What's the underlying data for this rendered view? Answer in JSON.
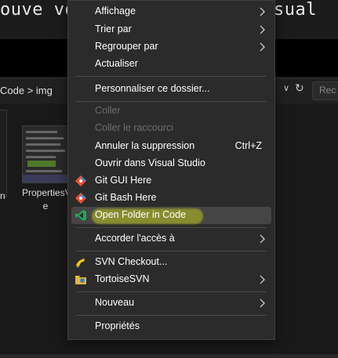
{
  "background": {
    "title_left": "ouve vo",
    "title_right": "sual",
    "address_path": "Code > img",
    "search_placeholder": "Rec",
    "left_tile_label": "n",
    "thumbnail_label": "PropertiesV e"
  },
  "context_menu": {
    "affichage": "Affichage",
    "trier_par": "Trier par",
    "regrouper_par": "Regrouper par",
    "actualiser": "Actualiser",
    "personnaliser": "Personnaliser ce dossier...",
    "coller": "Coller",
    "coller_raccourci": "Coller le raccourci",
    "annuler_suppression": "Annuler la suppression",
    "annuler_shortcut": "Ctrl+Z",
    "ouvrir_vs": "Ouvrir dans Visual Studio",
    "git_gui": "Git GUI Here",
    "git_bash": "Git Bash Here",
    "open_code": "Open Folder in Code",
    "accorder_acces": "Accorder l'accès à",
    "svn_checkout": "SVN Checkout...",
    "tortoise": "TortoiseSVN",
    "nouveau": "Nouveau",
    "proprietes": "Propriétés"
  },
  "icons": {
    "git_gui": "git-diamond-icon",
    "git_bash": "git-diamond-icon",
    "open_code": "vscode-icon",
    "svn_checkout": "svn-checkout-icon",
    "tortoise": "tortoise-svn-icon"
  },
  "colors": {
    "menu_bg": "#2b2b2b",
    "highlight_marker": "#c8cf1e",
    "git_orange": "#f05033",
    "vscode_green": "#23a95b"
  }
}
